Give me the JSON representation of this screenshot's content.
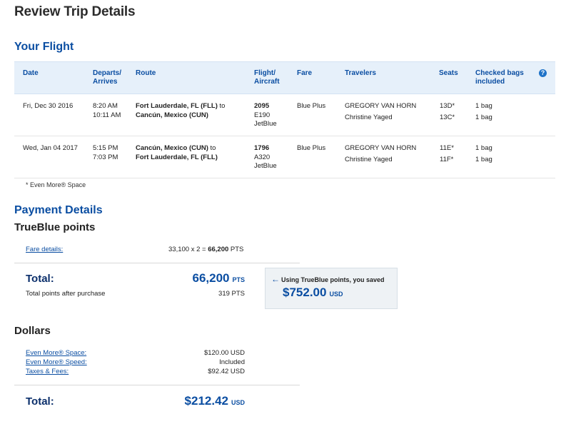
{
  "page_title": "Review Trip Details",
  "flight_section": {
    "title": "Your Flight",
    "headers": {
      "date": "Date",
      "departs_line1": "Departs/",
      "departs_line2": "Arrives",
      "route": "Route",
      "flight_line1": "Flight/",
      "flight_line2": "Aircraft",
      "fare": "Fare",
      "travelers": "Travelers",
      "seats": "Seats",
      "bags_line1": "Checked bags",
      "bags_line2": "included",
      "help_icon": "?"
    },
    "rows": [
      {
        "date": "Fri, Dec 30 2016",
        "depart": "8:20 AM",
        "arrive": "10:11 AM",
        "route_from": "Fort Lauderdale, FL (FLL)",
        "route_to_word": " to",
        "route_to": "Cancún, Mexico (CUN)",
        "flight": "2095",
        "aircraft": "E190",
        "carrier": "JetBlue",
        "fare": "Blue Plus",
        "traveler1": "GREGORY VAN HORN",
        "traveler2": "Christine Yaged",
        "seat1": "13D*",
        "seat2": "13C*",
        "bag1": "1 bag",
        "bag2": "1 bag"
      },
      {
        "date": "Wed, Jan 04 2017",
        "depart": "5:15 PM",
        "arrive": "7:03 PM",
        "route_from": "Cancún, Mexico (CUN)",
        "route_to_word": " to",
        "route_to": "Fort Lauderdale, FL (FLL)",
        "flight": "1796",
        "aircraft": "A320",
        "carrier": "JetBlue",
        "fare": "Blue Plus",
        "traveler1": "GREGORY VAN HORN",
        "traveler2": "Christine Yaged",
        "seat1": "11E*",
        "seat2": "11F*",
        "bag1": "1 bag",
        "bag2": "1 bag"
      }
    ],
    "footnote": "* Even More® Space"
  },
  "payment": {
    "title": "Payment Details",
    "points": {
      "title": "TrueBlue points",
      "fare_details_link": "Fare details:",
      "fare_calc": "33,100 x 2 = ",
      "fare_calc_total": "66,200",
      "fare_calc_unit": " PTS",
      "total_label": "Total:",
      "total_value": "66,200",
      "total_unit": "PTS",
      "after_purchase_label": "Total points after purchase",
      "after_purchase_value": "319 PTS",
      "saved_text": "Using TrueBlue points, you saved",
      "saved_amount": "$752.00",
      "saved_unit": "USD"
    },
    "dollars": {
      "title": "Dollars",
      "items": [
        {
          "label": "Even More® Space:",
          "value": "$120.00 USD"
        },
        {
          "label": "Even More® Speed:",
          "value": "Included"
        },
        {
          "label": "Taxes & Fees:",
          "value": "$92.42 USD"
        }
      ],
      "total_label": "Total:",
      "total_value": "$212.42",
      "total_unit": "USD"
    }
  }
}
